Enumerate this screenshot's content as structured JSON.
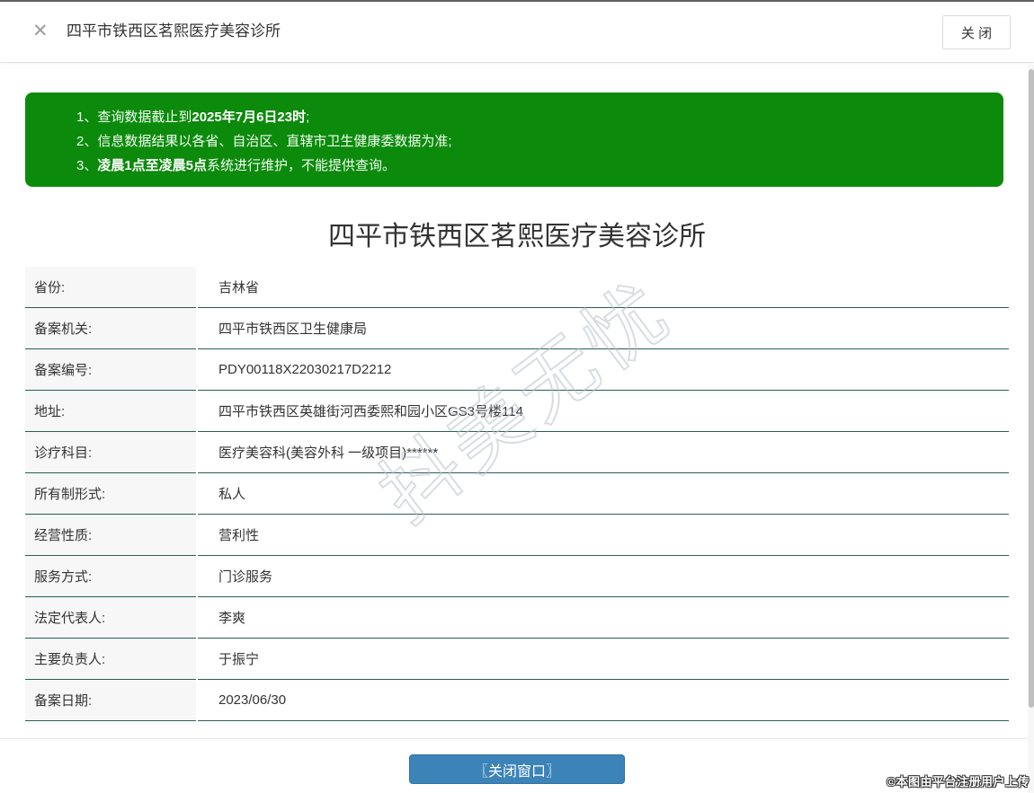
{
  "window": {
    "title": "四平市铁西区茗熙医疗美容诊所",
    "close_icon": "✕",
    "close_button_label": "关 闭"
  },
  "notice": {
    "items": [
      {
        "prefix": "1、",
        "pre": "查询数据截止到",
        "bold": "2025年7月6日23时",
        "post": ";"
      },
      {
        "prefix": "2、",
        "pre": "信息数据结果以各省、自治区、直辖市卫生健康委数据为准;",
        "bold": "",
        "post": ""
      },
      {
        "prefix": "3、",
        "pre": "",
        "bold": "凌晨1点至凌晨5点",
        "post": "系统进行维护，不能提供查询。"
      }
    ]
  },
  "detail": {
    "title": "四平市铁西区茗熙医疗美容诊所",
    "rows": [
      {
        "label": "省份:",
        "value": "吉林省"
      },
      {
        "label": "备案机关:",
        "value": "四平市铁西区卫生健康局"
      },
      {
        "label": "备案编号:",
        "value": "PDY00118X22030217D2212"
      },
      {
        "label": "地址:",
        "value": "四平市铁西区英雄街河西委熙和园小区GS3号楼114"
      },
      {
        "label": "诊疗科目:",
        "value": "医疗美容科(美容外科 一级项目)******"
      },
      {
        "label": "所有制形式:",
        "value": "私人"
      },
      {
        "label": "经营性质:",
        "value": "营利性"
      },
      {
        "label": "服务方式:",
        "value": "门诊服务"
      },
      {
        "label": "法定代表人:",
        "value": "李爽"
      },
      {
        "label": "主要负责人:",
        "value": "于振宁"
      },
      {
        "label": "备案日期:",
        "value": "2023/06/30"
      }
    ]
  },
  "footer": {
    "close_window_label": "〖关闭窗口〗"
  },
  "watermark": {
    "text": "抖美无忧"
  },
  "copyright": "©本图由平台注册用户上传",
  "colors": {
    "notice_green": "#0c8a0c",
    "button_blue": "#3c83b8",
    "table_divider_teal": "#2a5e56"
  }
}
